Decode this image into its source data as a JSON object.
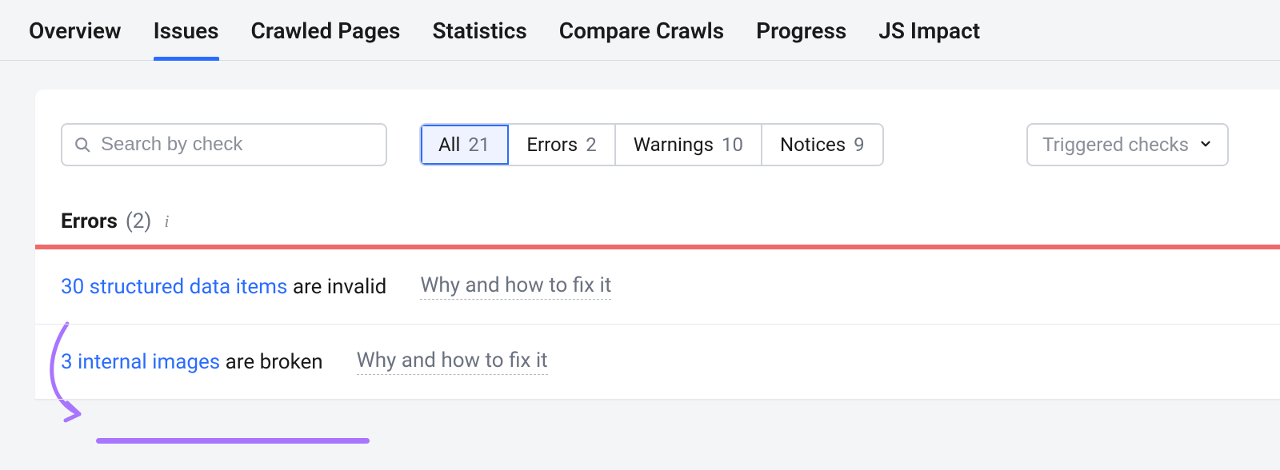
{
  "tabs": [
    {
      "label": "Overview",
      "active": false
    },
    {
      "label": "Issues",
      "active": true
    },
    {
      "label": "Crawled Pages",
      "active": false
    },
    {
      "label": "Statistics",
      "active": false
    },
    {
      "label": "Compare Crawls",
      "active": false
    },
    {
      "label": "Progress",
      "active": false
    },
    {
      "label": "JS Impact",
      "active": false
    }
  ],
  "search": {
    "placeholder": "Search by check"
  },
  "filters": {
    "items": [
      {
        "label": "All",
        "count": "21",
        "active": true
      },
      {
        "label": "Errors",
        "count": "2",
        "active": false
      },
      {
        "label": "Warnings",
        "count": "10",
        "active": false
      },
      {
        "label": "Notices",
        "count": "9",
        "active": false
      }
    ]
  },
  "dropdown": {
    "label": "Triggered checks"
  },
  "section": {
    "title": "Errors",
    "count": "(2)"
  },
  "issues": [
    {
      "link": "30 structured data items",
      "rest": " are invalid",
      "why": "Why and how to fix it"
    },
    {
      "link": "3 internal images",
      "rest": " are broken",
      "why": "Why and how to fix it"
    }
  ]
}
